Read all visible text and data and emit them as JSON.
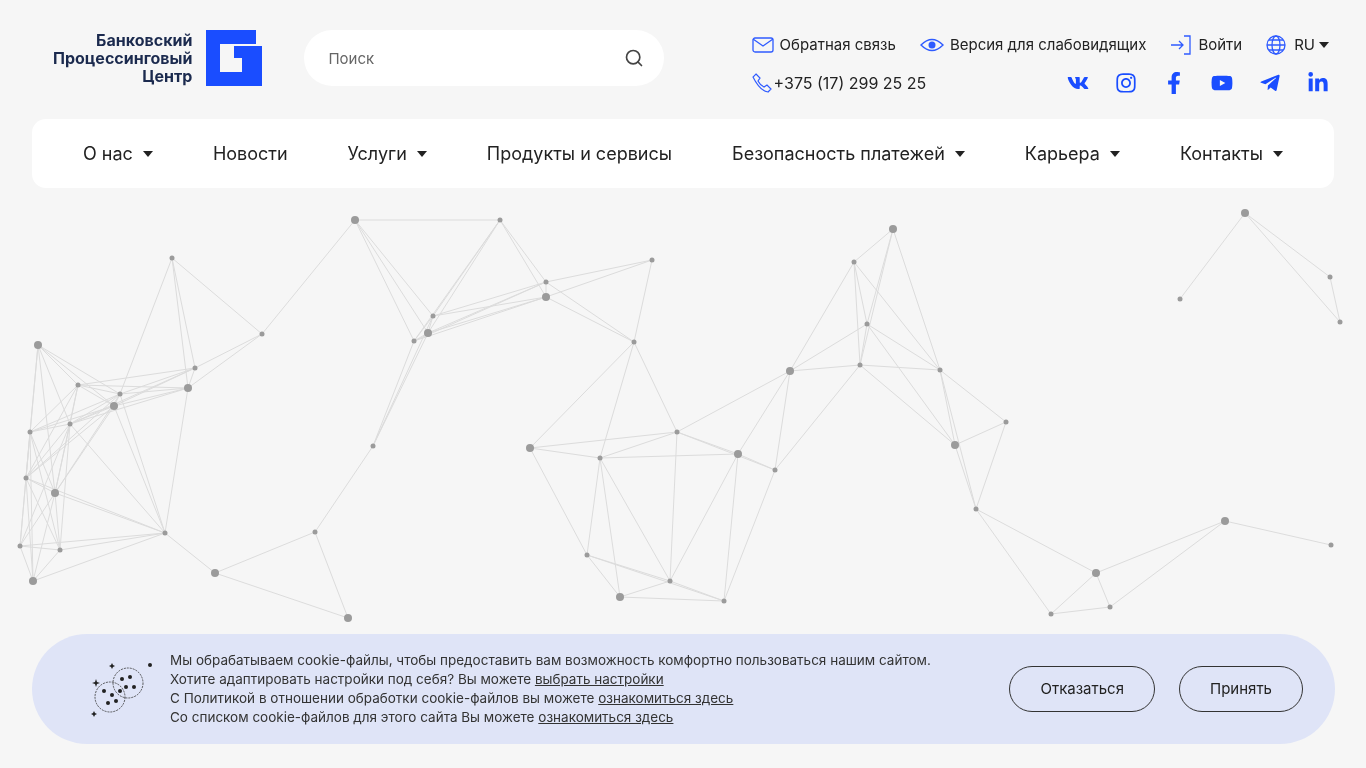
{
  "logo": {
    "lines": [
      "Банковский",
      "Процессинговый",
      "Центр"
    ]
  },
  "search": {
    "placeholder": "Поиск"
  },
  "top_links": {
    "feedback": "Обратная связь",
    "accessibility": "Версия для слабовидящих",
    "login": "Войти",
    "language": "RU",
    "phone": "+375 (17) 299 25 25"
  },
  "nav": [
    {
      "label": "О нас",
      "has_dropdown": true
    },
    {
      "label": "Новости",
      "has_dropdown": false
    },
    {
      "label": "Услуги",
      "has_dropdown": true
    },
    {
      "label": "Продукты и сервисы",
      "has_dropdown": false
    },
    {
      "label": "Безопасность платежей",
      "has_dropdown": true
    },
    {
      "label": "Карьера",
      "has_dropdown": true
    },
    {
      "label": "Контакты",
      "has_dropdown": true
    }
  ],
  "cookie_banner": {
    "lines": [
      {
        "text": "Мы обрабатываем cookie-файлы, чтобы предоставить вам возможность комфортно пользоваться нашим сайтом."
      },
      {
        "text": "Хотите адаптировать настройки под себя? Вы можете",
        "link": "выбрать настройки"
      },
      {
        "text": "С Политикой в отношении обработки cookie-файлов вы можете",
        "link": "ознакомиться здесь"
      },
      {
        "text": "Со списком cookie-файлов для этого сайта Вы можете",
        "link": "ознакомиться здесь"
      }
    ],
    "buttons": [
      "Отказаться",
      "Принять"
    ]
  }
}
